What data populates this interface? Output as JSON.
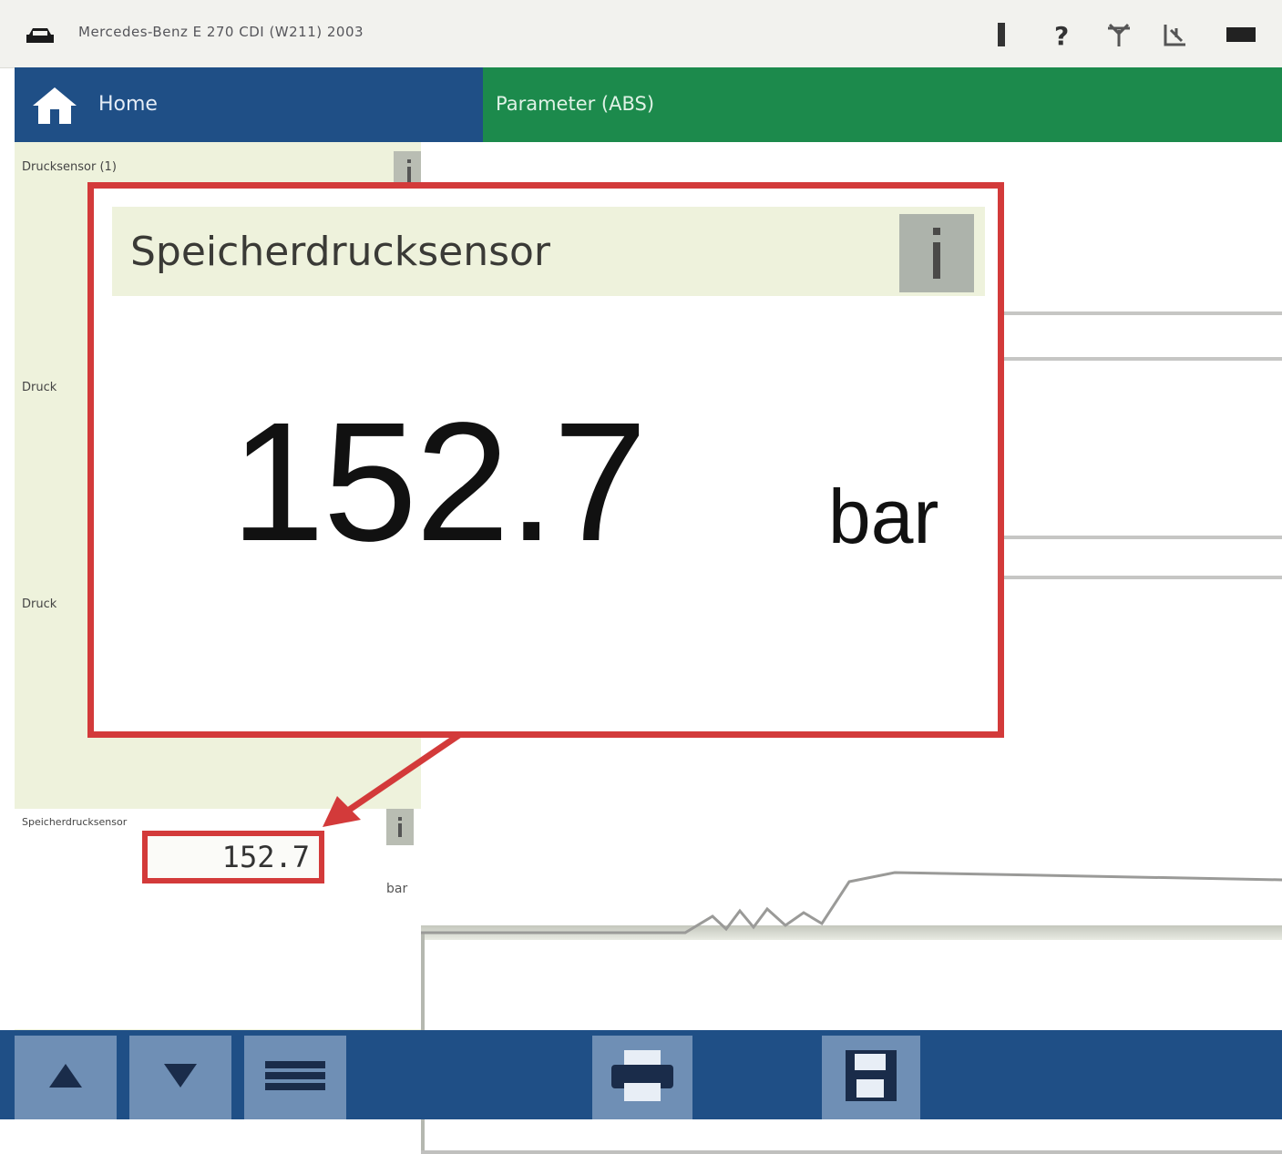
{
  "header": {
    "title": "Mercedes-Benz E 270 CDI (W211) 2003",
    "icons": [
      "car-icon",
      "battery-icon",
      "help-icon",
      "signal-icon",
      "connection-icon",
      "window-icon"
    ]
  },
  "nav": {
    "home_label": "Home",
    "tab_label": "Parameter (ABS)"
  },
  "left_panel": {
    "params": [
      {
        "label": "Drucksensor (1)"
      },
      {
        "label": "Druck"
      },
      {
        "label": "Druck"
      },
      {
        "label": "Speicherdrucksensor",
        "value": "152.7",
        "unit": "bar"
      }
    ]
  },
  "popup": {
    "title": "Speicherdrucksensor",
    "value": "152.7",
    "unit": "bar"
  },
  "toolbar": {
    "buttons": [
      "arrow-up-icon",
      "arrow-down-icon",
      "list-icon",
      "print-icon",
      "save-icon"
    ]
  },
  "colors": {
    "home_blue": "#1f4f86",
    "tab_green": "#1c8a4c",
    "highlight_red": "#d33a3a",
    "panel_bg": "#eef2dc"
  }
}
